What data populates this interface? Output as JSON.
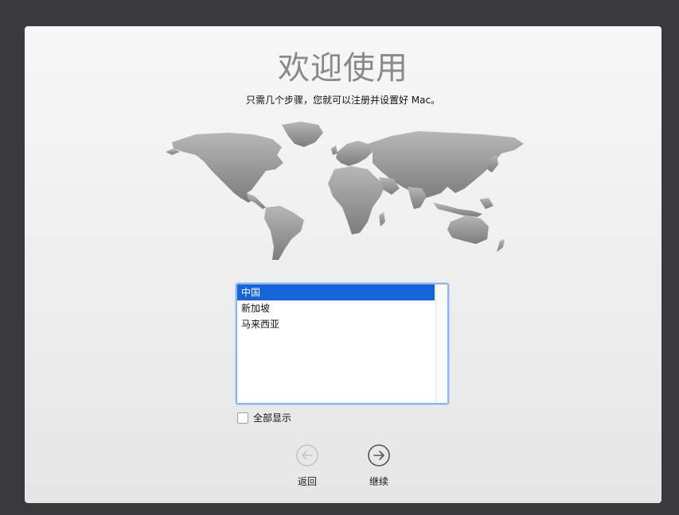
{
  "window": {
    "title": "欢迎使用",
    "subtitle": "只需几个步骤，您就可以注册并设置好 Mac。"
  },
  "region_list": {
    "items": [
      {
        "label": "中国",
        "selected": true
      },
      {
        "label": "新加坡",
        "selected": false
      },
      {
        "label": "马来西亚",
        "selected": false
      }
    ]
  },
  "show_all": {
    "label": "全部显示",
    "checked": false
  },
  "nav": {
    "back_label": "返回",
    "continue_label": "继续"
  },
  "colors": {
    "selection": "#1565d9",
    "focus_ring": "#8db4ec",
    "map_gray": "#8f8f8f"
  }
}
